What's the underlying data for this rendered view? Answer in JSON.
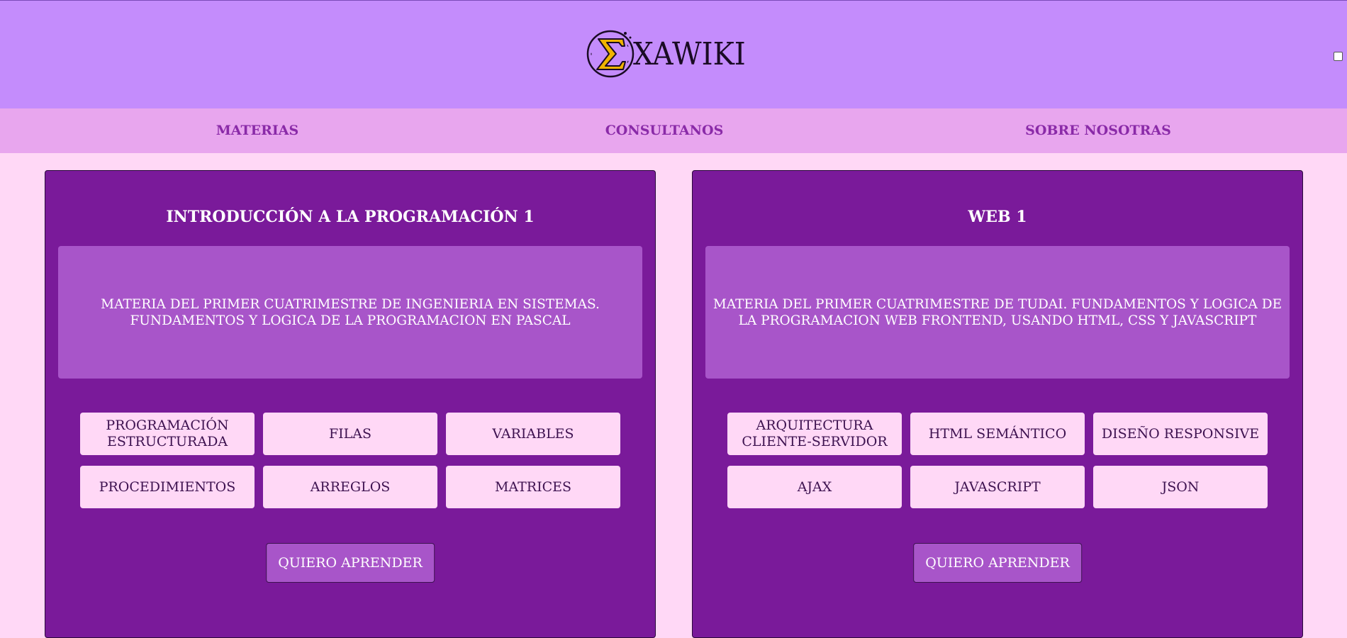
{
  "header": {
    "logo_icon": "sigma-circle-logo",
    "logo_text": "XAWIKI"
  },
  "nav": {
    "items": [
      {
        "label": "MATERIAS"
      },
      {
        "label": "CONSULTANOS"
      },
      {
        "label": "SOBRE NOSOTRAS"
      }
    ]
  },
  "courses": [
    {
      "title": "INTRODUCCIÓN A LA PROGRAMACIÓN 1",
      "description": "MATERIA DEL PRIMER CUATRIMESTRE DE INGENIERIA EN SISTEMAS. FUNDAMENTOS Y LOGICA DE LA PROGRAMACION EN PASCAL",
      "topics": [
        "PROGRAMACIÓN ESTRUCTURADA",
        "FILAS",
        "VARIABLES",
        "PROCEDIMIENTOS",
        "ARREGLOS",
        "MATRICES"
      ],
      "button": "QUIERO APRENDER"
    },
    {
      "title": "WEB 1",
      "description": "MATERIA DEL PRIMER CUATRIMESTRE DE TUDAI. FUNDAMENTOS Y LOGICA DE LA PROGRAMACION WEB FRONTEND, USANDO HTML, CSS Y JAVASCRIPT",
      "topics": [
        "ARQUITECTURA CLIENTE-SERVIDOR",
        "HTML SEMÁNTICO",
        "DISEÑO RESPONSIVE",
        "AJAX",
        "JAVASCRIPT",
        "JSON"
      ],
      "button": "QUIERO APRENDER"
    }
  ],
  "colors": {
    "header_bg": "#c48cfc",
    "nav_bg": "#e8a6ee",
    "page_bg": "#ffd8f6",
    "card_bg": "#7a1a9a",
    "desc_bg": "#a855c9",
    "nav_text": "#8a2aa8",
    "logo_accent": "#f0b400"
  }
}
